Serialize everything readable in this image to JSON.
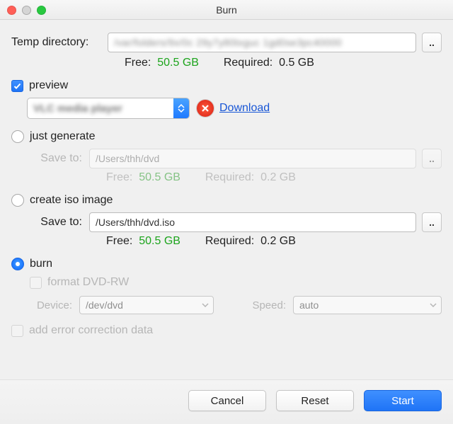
{
  "window": {
    "title": "Burn"
  },
  "temp": {
    "label": "Temp directory:",
    "path_obscured": "/var/folders/9x/0c 29y7y80txguc 1gd0se3pc40000",
    "browse": "..",
    "stats": {
      "free_label": "Free:",
      "free": "50.5 GB",
      "req_label": "Required:",
      "req": "0.5 GB"
    }
  },
  "preview": {
    "label": "preview",
    "player_obscured": "VLC media player",
    "download": "Download"
  },
  "just_generate": {
    "label": "just generate",
    "saveto_label": "Save to:",
    "path": "/Users/thh/dvd",
    "browse": "..",
    "stats": {
      "free_label": "Free:",
      "free": "50.5 GB",
      "req_label": "Required:",
      "req": "0.2 GB"
    }
  },
  "iso": {
    "label": "create iso image",
    "saveto_label": "Save to:",
    "path": "/Users/thh/dvd.iso",
    "browse": "..",
    "stats": {
      "free_label": "Free:",
      "free": "50.5 GB",
      "req_label": "Required:",
      "req": "0.2 GB"
    }
  },
  "burn": {
    "label": "burn",
    "format_label": "format DVD-RW",
    "device_label": "Device:",
    "device_value": "/dev/dvd",
    "speed_label": "Speed:",
    "speed_value": "auto"
  },
  "ecc": {
    "label": "add error correction data"
  },
  "footer": {
    "cancel": "Cancel",
    "reset": "Reset",
    "start": "Start"
  }
}
